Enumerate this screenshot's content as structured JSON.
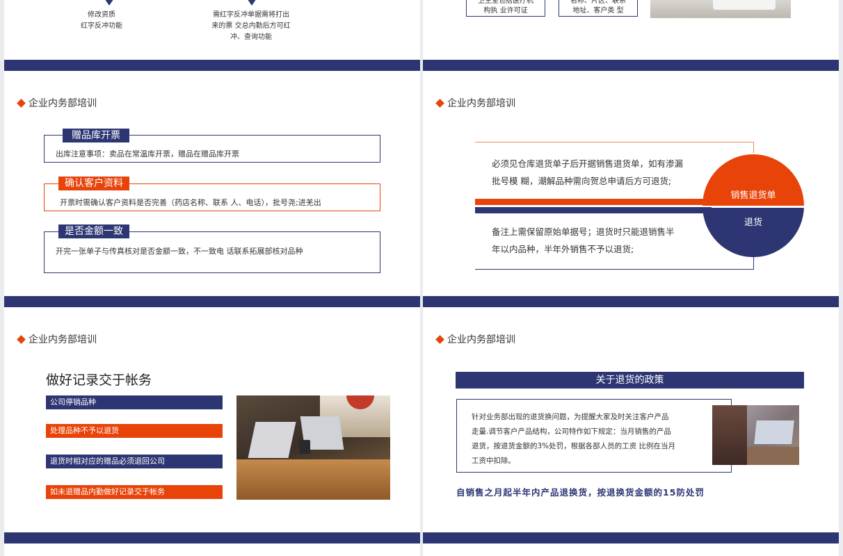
{
  "colors": {
    "navy": "#2d3673",
    "orange": "#e8440a",
    "accent_line": "#f08a5d"
  },
  "slide1": {
    "caption_left": [
      "修改资质",
      "红字反冲功能"
    ],
    "caption_right": [
      "需红字反冲单据需将打出",
      "来的票 交总内勤后方可红",
      "冲、查询功能"
    ]
  },
  "slide2": {
    "box_left": [
      "卫生室包括医疗机",
      "构执 业许可证"
    ],
    "box_right": [
      "名称、片区、联系",
      "地址、客户类 型"
    ]
  },
  "slide3": {
    "heading": "企业内务部培训",
    "items": [
      {
        "label": "赠品库开票",
        "text": "出库注意事项：卖品在常温库开票，赠品在赠品库开票"
      },
      {
        "label": "确认客户资料",
        "text": "开票时需确认客户资料是否完善（药店名称、联系  人、电话），批号尧;进羌出"
      },
      {
        "label": "是否金额一致",
        "text": "开完一张单子与传真核对是否金额一致，不一致电  话联系拓展部核对品种"
      }
    ]
  },
  "slide4": {
    "heading": "企业内务部培训",
    "top_text": [
      "必须见仓库退货单子后开据销售退货单，如有渗漏",
      "批号模 糊，潮解品种需向贺总申请后方可退货;"
    ],
    "bottom_text": [
      "备注上需保留原始单据号；退货时只能退销售半",
      "年以内品种，半年外销售不予以退货;"
    ],
    "circle_top": "销售退货单",
    "circle_bottom": "退货"
  },
  "slide5": {
    "heading": "企业内务部培训",
    "title": "做好记录交于帐务",
    "items": [
      "公司停销品种",
      "处理品种不予以退货",
      "退货时相对应的赠品必须退回公司",
      "如未退赠品内勤做好记录交于帐务"
    ]
  },
  "slide6": {
    "heading": "企业内务部培训",
    "title": "关于退货的政策",
    "body": [
      "针对业务部出现的退货换问题，为提醒大家及时关注客户产品",
      "走量.调节客户产品结构，公司特作如下规定：当月销售的产品",
      "退货，按退货金额的3%处罚，根据各部人员的工资  比例在当月",
      "工资中扣除。"
    ],
    "footer": "自销售之月起半年内产品退换货，按退换货金额的15防处罚"
  }
}
